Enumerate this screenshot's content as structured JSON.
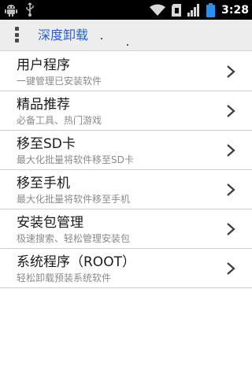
{
  "status_bar": {
    "time": "3:28",
    "icons": [
      "android-debug-icon",
      "usb-icon",
      "wifi-icon",
      "sd-card-icon",
      "signal-icon",
      "battery-icon"
    ],
    "battery_color": "#2f8fe8"
  },
  "header": {
    "title": "深度卸载",
    "menu_icon": "menu-dots-icon",
    "title_color": "#2a5fc9"
  },
  "list": {
    "items": [
      {
        "title": "用户程序",
        "subtitle": "一键管理已安装软件"
      },
      {
        "title": "精品推荐",
        "subtitle": "必备工具、热门游戏"
      },
      {
        "title": "移至SD卡",
        "subtitle": "最大化批量将软件移至SD卡"
      },
      {
        "title": "移至手机",
        "subtitle": "最大化批量将软件移至手机"
      },
      {
        "title": "安装包管理",
        "subtitle": "极速搜索、轻松管理安装包"
      },
      {
        "title": "系统程序（ROOT）",
        "subtitle": "轻松卸载预装系统软件"
      }
    ],
    "chevron_icon": "chevron-right-icon"
  }
}
